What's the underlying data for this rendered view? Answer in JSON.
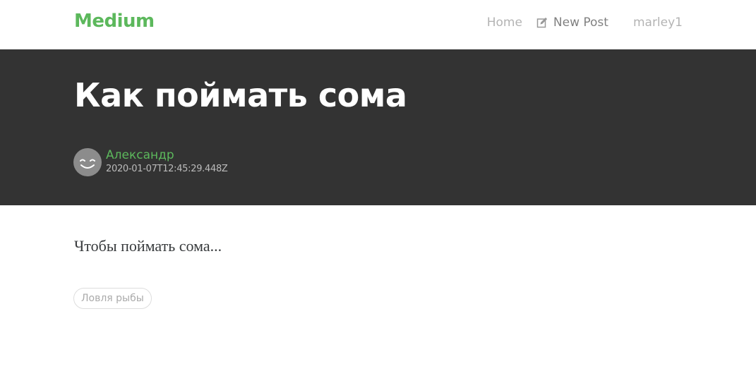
{
  "navbar": {
    "brand": "Medium",
    "home_label": "Home",
    "new_post_label": "New Post",
    "new_post_icon": "edit-icon",
    "username": "marley1"
  },
  "article": {
    "title": "Как поймать сома",
    "author": {
      "name": "Александр",
      "avatar_icon": "smiley-avatar"
    },
    "date": "2020-01-07T12:45:29.448Z",
    "body": "Чтобы поймать сома...",
    "tags": [
      "Ловля рыбы"
    ]
  },
  "colors": {
    "brand": "#5cb85c",
    "banner_bg": "#333333",
    "nav_text": "#aaaaaa",
    "body_text": "#373a3c"
  }
}
